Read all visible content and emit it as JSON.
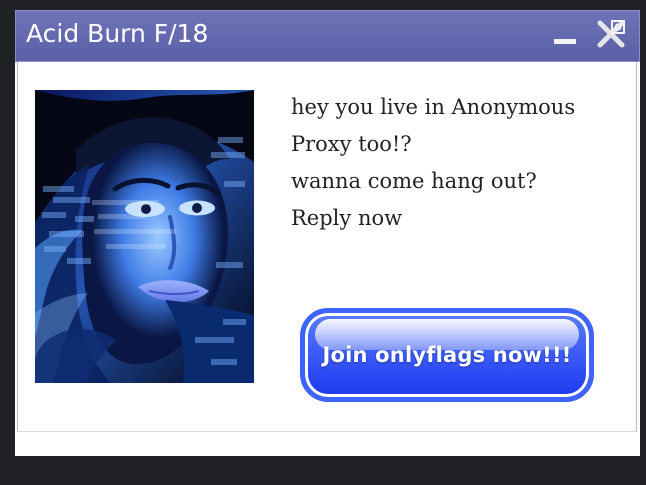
{
  "window": {
    "title": "Acid Burn F/18",
    "controls": {
      "minimize_icon": "minimize-icon",
      "close_icon": "close-icon"
    }
  },
  "message": {
    "lines": [
      "hey you live in Anonymous",
      "Proxy too!?",
      "wanna come hang out?",
      "Reply now"
    ]
  },
  "cta": {
    "label": "Join onlyflags now!!!"
  },
  "colors": {
    "titlebar": "#6f74b8",
    "button_blue": "#1c39ef",
    "background": "#202124"
  },
  "image": {
    "subject": "blue-toned portrait with hacker text overlay"
  }
}
